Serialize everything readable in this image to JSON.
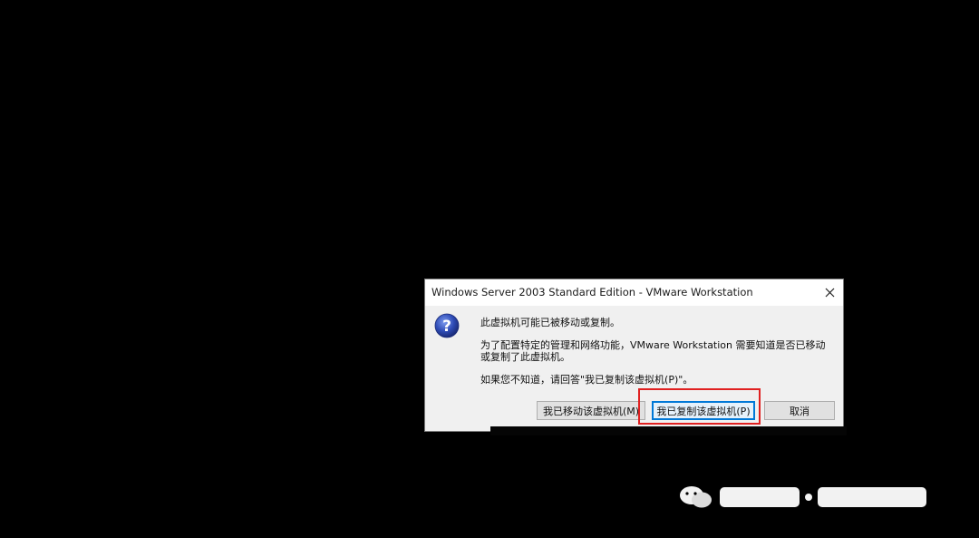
{
  "dialog": {
    "title": "Windows Server 2003 Standard Edition - VMware Workstation",
    "line1": "此虚拟机可能已被移动或复制。",
    "line2": "为了配置特定的管理和网络功能，VMware Workstation 需要知道是否已移动",
    "line3": "或复制了此虚拟机。",
    "line4": "如果您不知道，请回答\"我已复制该虚拟机(P)\"。",
    "buttons": {
      "moved": "我已移动该虚拟机(M)",
      "copied": "我已复制该虚拟机(P)",
      "cancel": "取消"
    },
    "icons": {
      "question": "question-icon",
      "close": "close-icon"
    }
  },
  "colors": {
    "highlight": "#e02020",
    "focus": "#0078d7",
    "question_icon": "#2e4bb5"
  }
}
